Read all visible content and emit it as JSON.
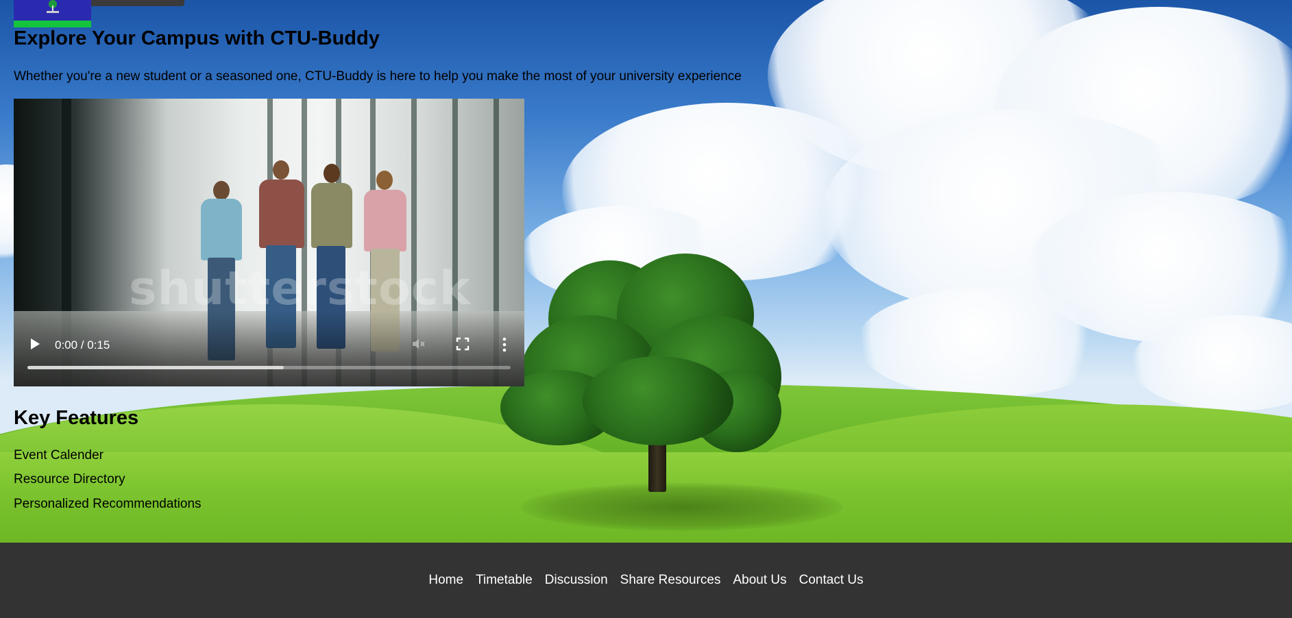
{
  "hero": {
    "title": "Explore Your Campus with CTU-Buddy",
    "subtitle": "Whether you're a new student or a seasoned one, CTU-Buddy is here to help you make the most of your university experience"
  },
  "video": {
    "time_display": "0:00 / 0:15",
    "watermark": "shutterstock",
    "buffered_fraction": 0.53,
    "controls": {
      "play_icon": "play-icon",
      "volume_icon": "volume-muted-icon",
      "fullscreen_icon": "fullscreen-icon",
      "more_icon": "more-vertical-icon"
    }
  },
  "features": {
    "title": "Key Features",
    "items": [
      "Event Calender",
      "Resource Directory",
      "Personalized Recommendations"
    ]
  },
  "footer": {
    "nav": [
      "Home",
      "Timetable",
      "Discussion",
      "Share Resources",
      "About Us",
      "Contact Us"
    ]
  },
  "colors": {
    "footer_bg": "#333333",
    "logo_blue": "#2a2ab0",
    "logo_green": "#14c43c"
  }
}
